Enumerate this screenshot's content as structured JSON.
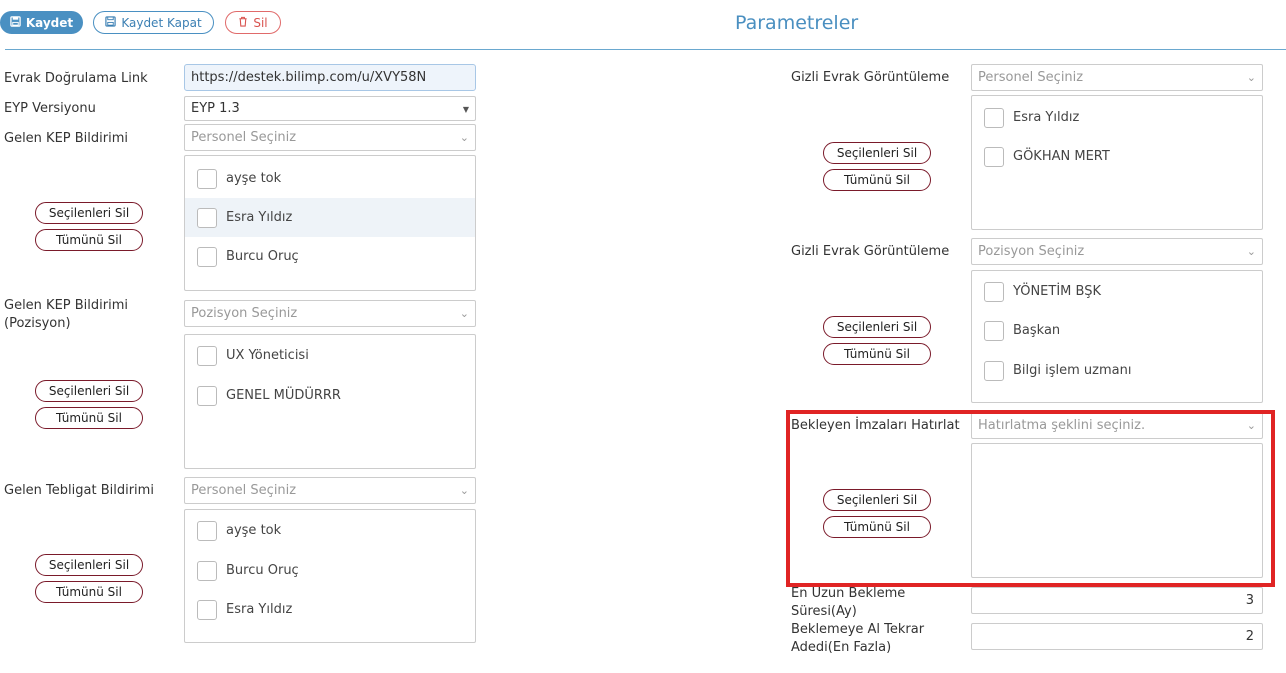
{
  "toolbar": {
    "save_label": "Kaydet",
    "save_close_label": "Kaydet Kapat",
    "delete_label": "Sil",
    "colors": {
      "primary": "#4a90c2",
      "danger": "#d9534f"
    }
  },
  "page_title": "Parametreler",
  "left": {
    "link_label": "Evrak Doğrulama Link",
    "link_value": "https://destek.bilimp.com/u/XVY58N",
    "eyp_label": "EYP Versiyonu",
    "eyp_value": "EYP 1.3",
    "kep_label": "Gelen KEP Bildirimi",
    "kep_placeholder": "Personel Seçiniz",
    "kep_items": [
      "ayşe tok",
      "Esra Yıldız",
      "Burcu Oruç"
    ],
    "kep_pos_label": "Gelen KEP Bildirimi (Pozisyon)",
    "kep_pos_placeholder": "Pozisyon Seçiniz",
    "kep_pos_items": [
      "UX Yöneticisi",
      "GENEL MÜDÜRRR"
    ],
    "teb_label": "Gelen Tebligat Bildirimi",
    "teb_placeholder": "Personel Seçiniz",
    "teb_items": [
      "ayşe tok",
      "Burcu Oruç",
      "Esra Yıldız"
    ]
  },
  "right": {
    "gizli1_label": "Gizli Evrak Görüntüleme",
    "gizli1_placeholder": "Personel Seçiniz",
    "gizli1_items": [
      "Esra Yıldız",
      "GÖKHAN MERT"
    ],
    "gizli2_label": "Gizli Evrak Görüntüleme",
    "gizli2_placeholder": "Pozisyon Seçiniz",
    "gizli2_items": [
      "YÖNETİM BŞK",
      "Başkan",
      "Bilgi işlem uzmanı"
    ],
    "bekleyen_label": "Bekleyen İmzaları Hatırlat",
    "bekleyen_placeholder": "Hatırlatma şeklini seçiniz.",
    "sure_label": "En Uzun Bekleme Süresi(Ay)",
    "sure_value": "3",
    "tekrar_label": "Beklemeye Al Tekrar Adedi(En Fazla)",
    "tekrar_value": "2"
  },
  "common": {
    "delete_selected": "Seçilenleri Sil",
    "delete_all": "Tümünü Sil"
  }
}
